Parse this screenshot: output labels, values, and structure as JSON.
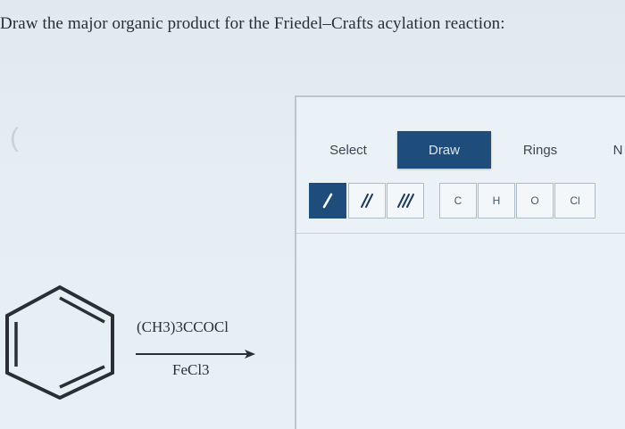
{
  "question": {
    "text": "Draw the major organic product for the Friedel–Crafts acylation reaction:"
  },
  "decorations": {
    "left_paren": "("
  },
  "sketcher": {
    "tabs": [
      {
        "label": "Select",
        "active": false
      },
      {
        "label": "Draw",
        "active": true
      },
      {
        "label": "Rings",
        "active": false
      },
      {
        "label": "N",
        "active": false
      }
    ],
    "bond_tools": [
      {
        "icon": "single-bond-icon",
        "active": true
      },
      {
        "icon": "double-bond-icon",
        "active": false
      },
      {
        "icon": "triple-bond-icon",
        "active": false
      }
    ],
    "atom_tools": [
      "C",
      "H",
      "O",
      "Cl"
    ],
    "colors": {
      "accent": "#1e4d7c",
      "button_bg": "#f3f7fa",
      "button_border": "#aebcc6"
    }
  },
  "reaction": {
    "reactant_icon": "benzene-ring-icon",
    "reagent_above": "(CH3)3CCOCl",
    "reagent_below": "FeCl3"
  }
}
